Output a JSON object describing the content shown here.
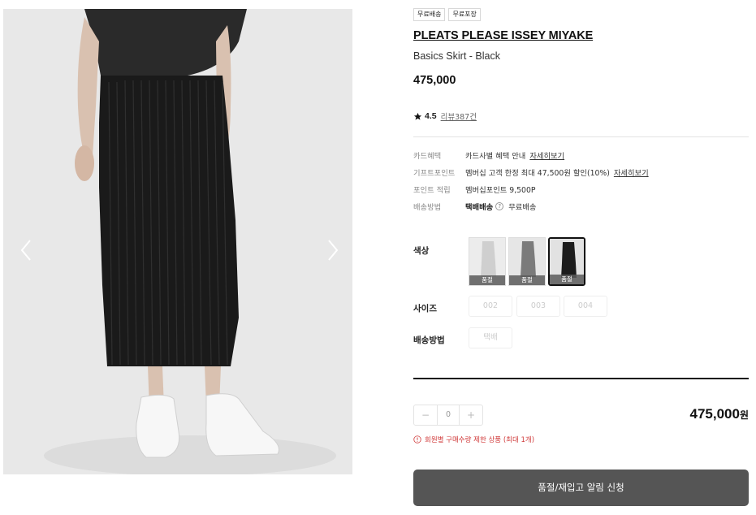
{
  "badges": [
    "무료배송",
    "무료포장"
  ],
  "product": {
    "brand": "PLEATS PLEASE ISSEY MIYAKE",
    "name": "Basics Skirt - Black",
    "price": "475,000"
  },
  "rating": {
    "score": "4.5",
    "reviews": "리뷰387건"
  },
  "info": {
    "card": {
      "label": "카드혜택",
      "value": "카드사별 혜택 안내",
      "link": "자세히보기"
    },
    "gift": {
      "label": "기프트포인트",
      "value": "멤버십 고객 한정 최대 47,500원 할인(10%)",
      "link": "자세히보기"
    },
    "points": {
      "label": "포인트 적립",
      "value": "멤버십포인트 9,500P"
    },
    "delivery": {
      "label": "배송방법",
      "method": "택배배송",
      "help": "?",
      "fee": "무료배송"
    }
  },
  "options": {
    "color_label": "색상",
    "colors": [
      {
        "name": "light-gray",
        "swatch": "#cfcfcf",
        "status": "품절",
        "selected": false
      },
      {
        "name": "gray",
        "swatch": "#7b7b7b",
        "status": "품절",
        "selected": false
      },
      {
        "name": "black",
        "swatch": "#1c1c1c",
        "status": "품절",
        "selected": true
      }
    ],
    "size_label": "사이즈",
    "sizes": [
      "002",
      "003",
      "004"
    ],
    "ship_label": "배송방법",
    "ship_options": [
      "택배"
    ]
  },
  "order": {
    "minus": "−",
    "quantity": "0",
    "plus": "+",
    "total": "475,000",
    "currency": "원",
    "warning": "회원별 구매수량 제한 상품 (최대 1개)",
    "button": "품절/재입고 알림 신청"
  },
  "colors": {
    "button_bg": "#555555",
    "warning": "#d03a3a",
    "divider": "#111111"
  }
}
